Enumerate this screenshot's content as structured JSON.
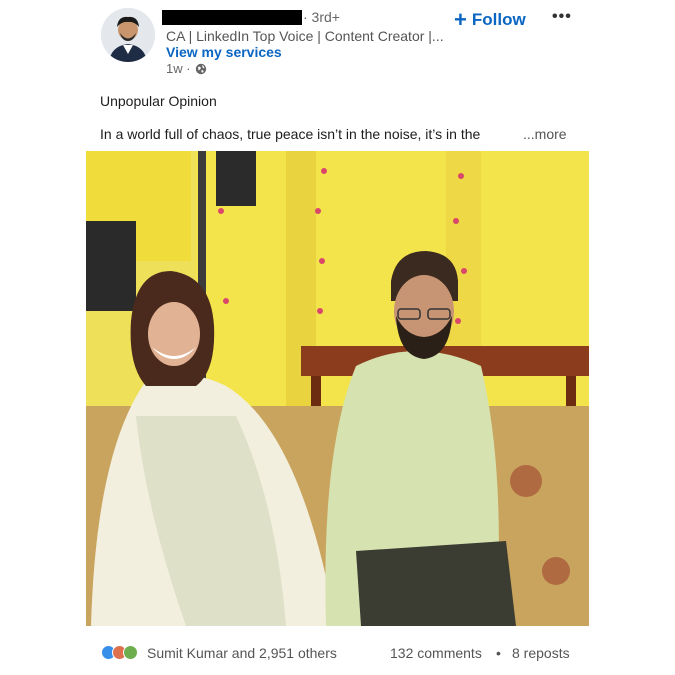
{
  "author": {
    "degree": "· 3rd+",
    "headline": "CA | LinkedIn Top Voice | Content Creator |...",
    "services_link": "View my services",
    "time": "1w ·",
    "avatar_icon": "profile-photo",
    "visibility_icon": "globe-icon"
  },
  "actions": {
    "follow_label": "Follow",
    "follow_icon": "+",
    "more_icon": "•••"
  },
  "post": {
    "title": "Unpopular Opinion",
    "body": "In a world full of chaos, true peace isn’t in the noise, it’s in the",
    "see_more": "...more"
  },
  "social": {
    "reaction_icons": [
      "like-icon",
      "love-icon",
      "celebrate-icon"
    ],
    "reactions_text": "Sumit Kumar and 2,951 others",
    "comments": "132 comments",
    "separator": "•",
    "reposts": "8 reposts"
  },
  "colors": {
    "link_blue": "#0a66c2",
    "muted_text": "#555555",
    "curtain_yellow": "#f2e24a"
  }
}
